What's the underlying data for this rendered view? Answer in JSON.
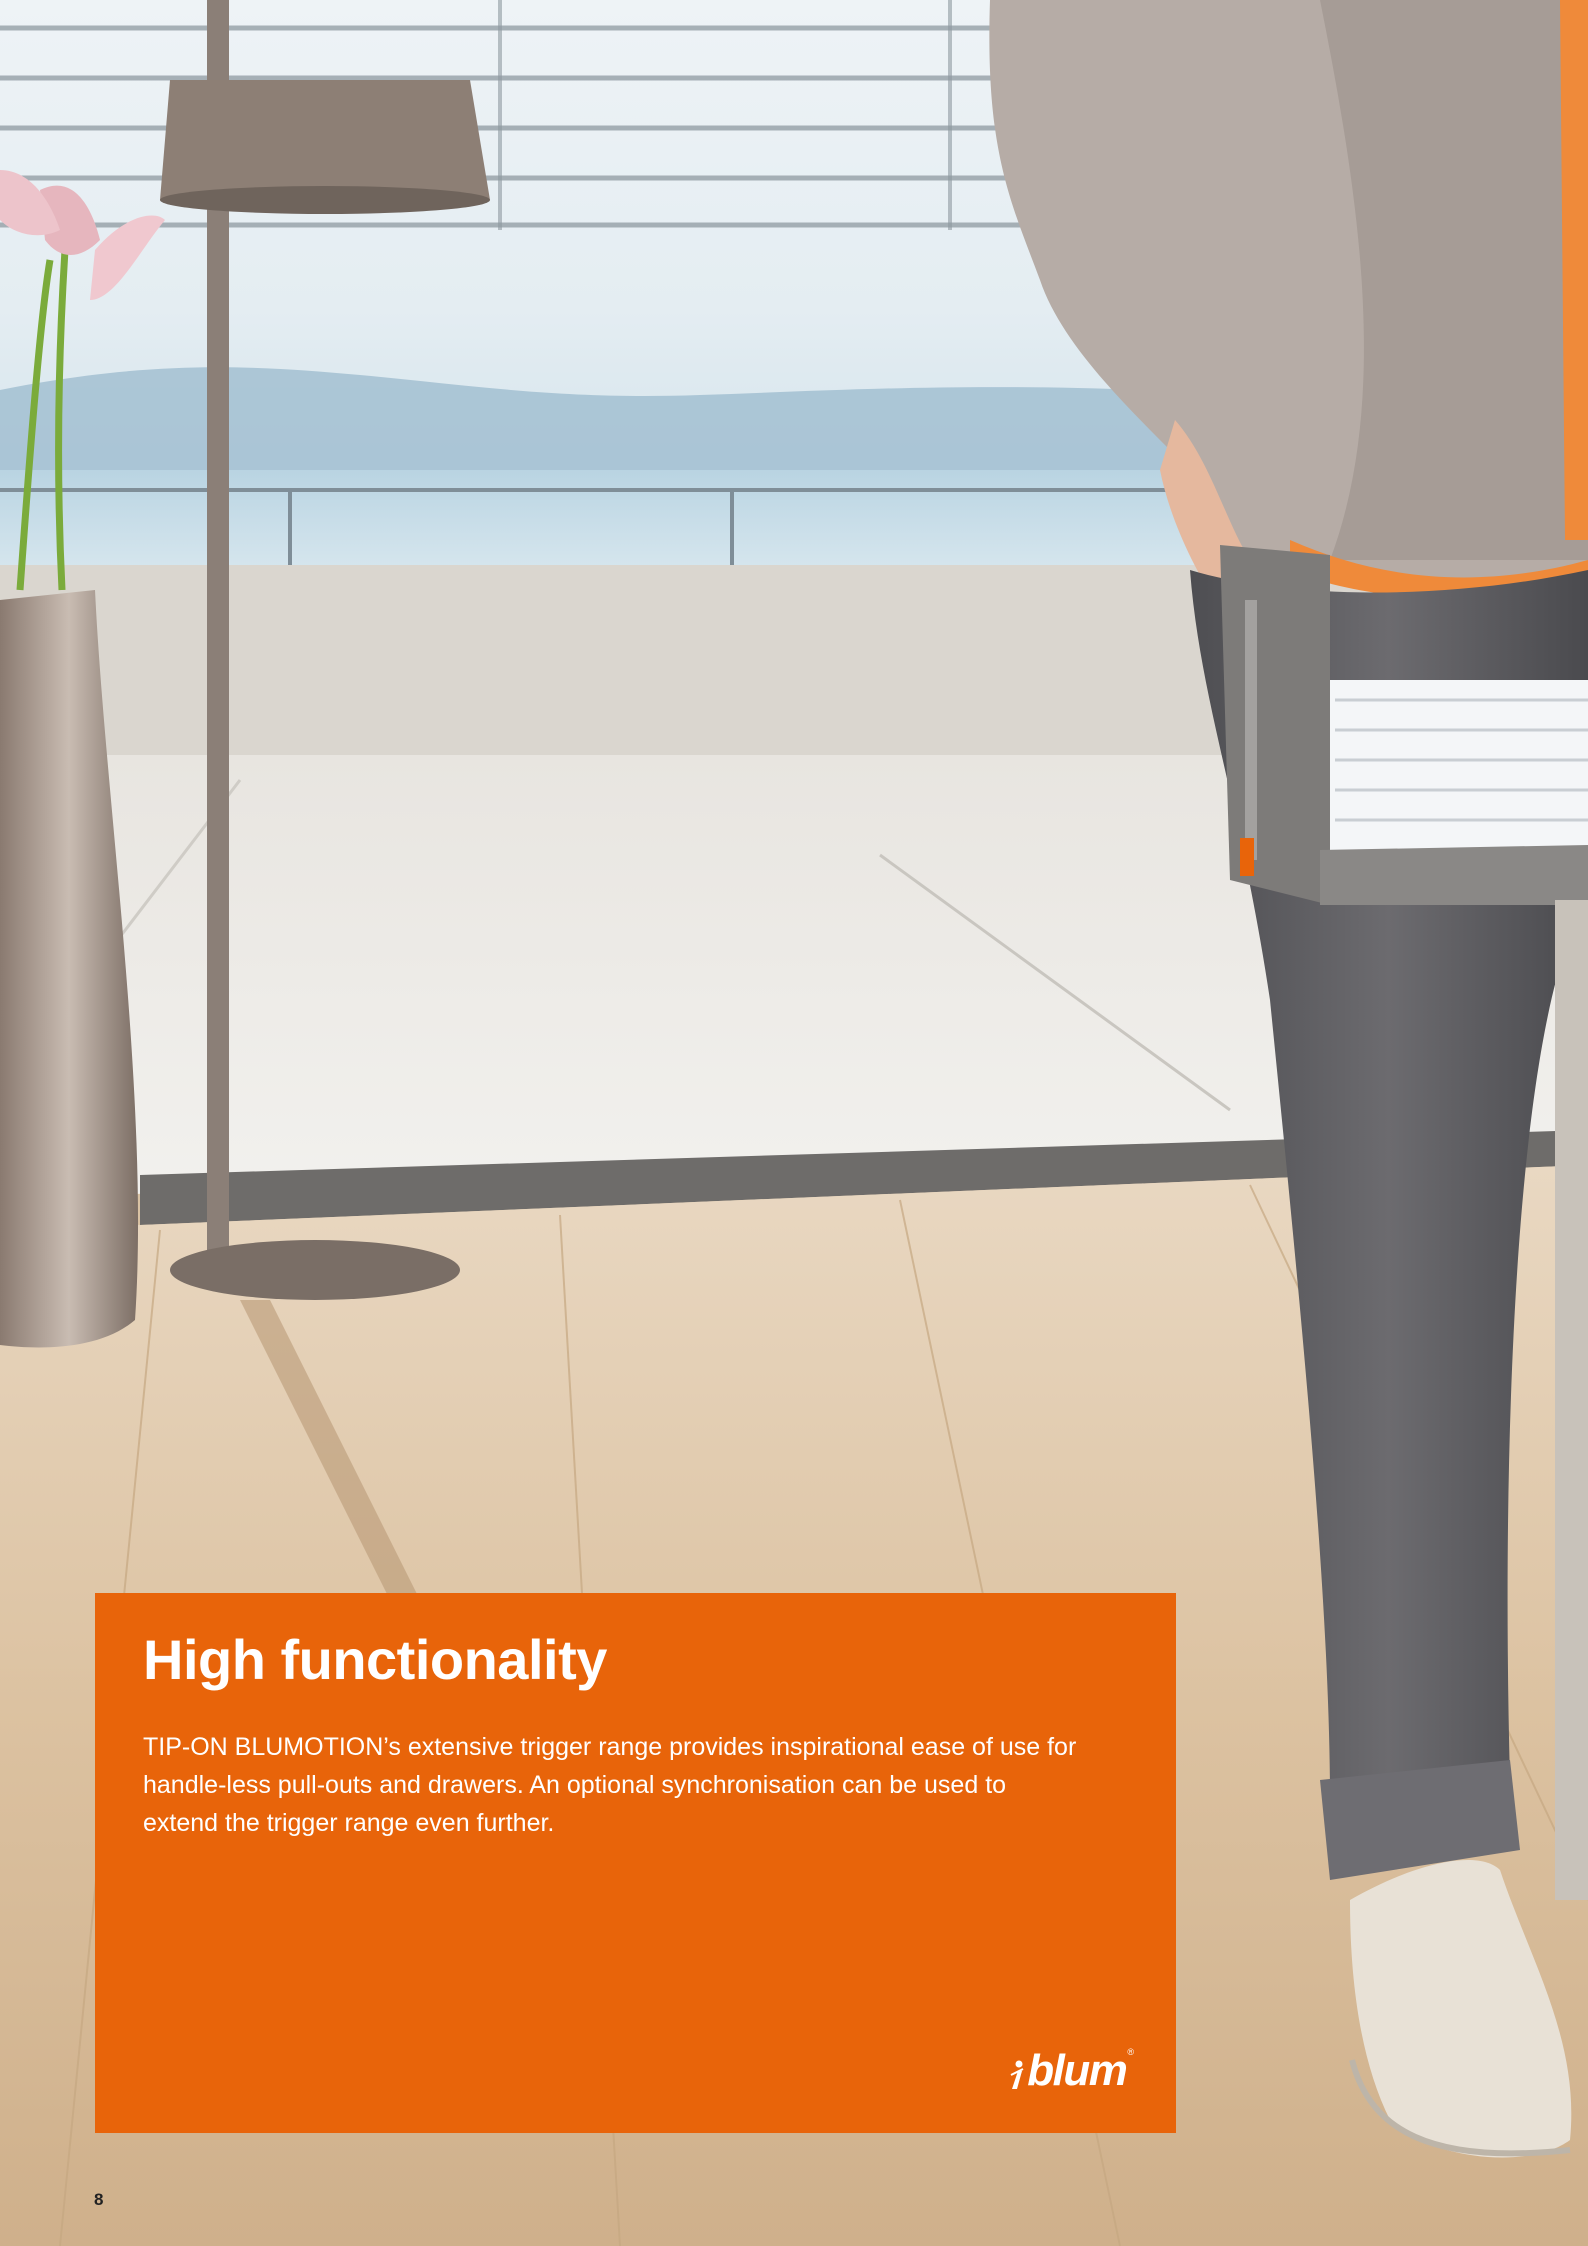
{
  "heading": "High functionality",
  "body_text": "TIP-ON BLUMOTION’s extensive trigger range provides inspirational ease of use for handle-less pull-outs and drawers. An optional synchronisation can be used to extend the trigger range even further.",
  "brand": {
    "name": "blum",
    "registered_mark": "®"
  },
  "page_number": "8",
  "colors": {
    "accent": "#e8640a",
    "text_on_accent": "#ffffff",
    "page_number": "#222222"
  },
  "photo_icons": {
    "scene": "interior-photo-icon"
  }
}
